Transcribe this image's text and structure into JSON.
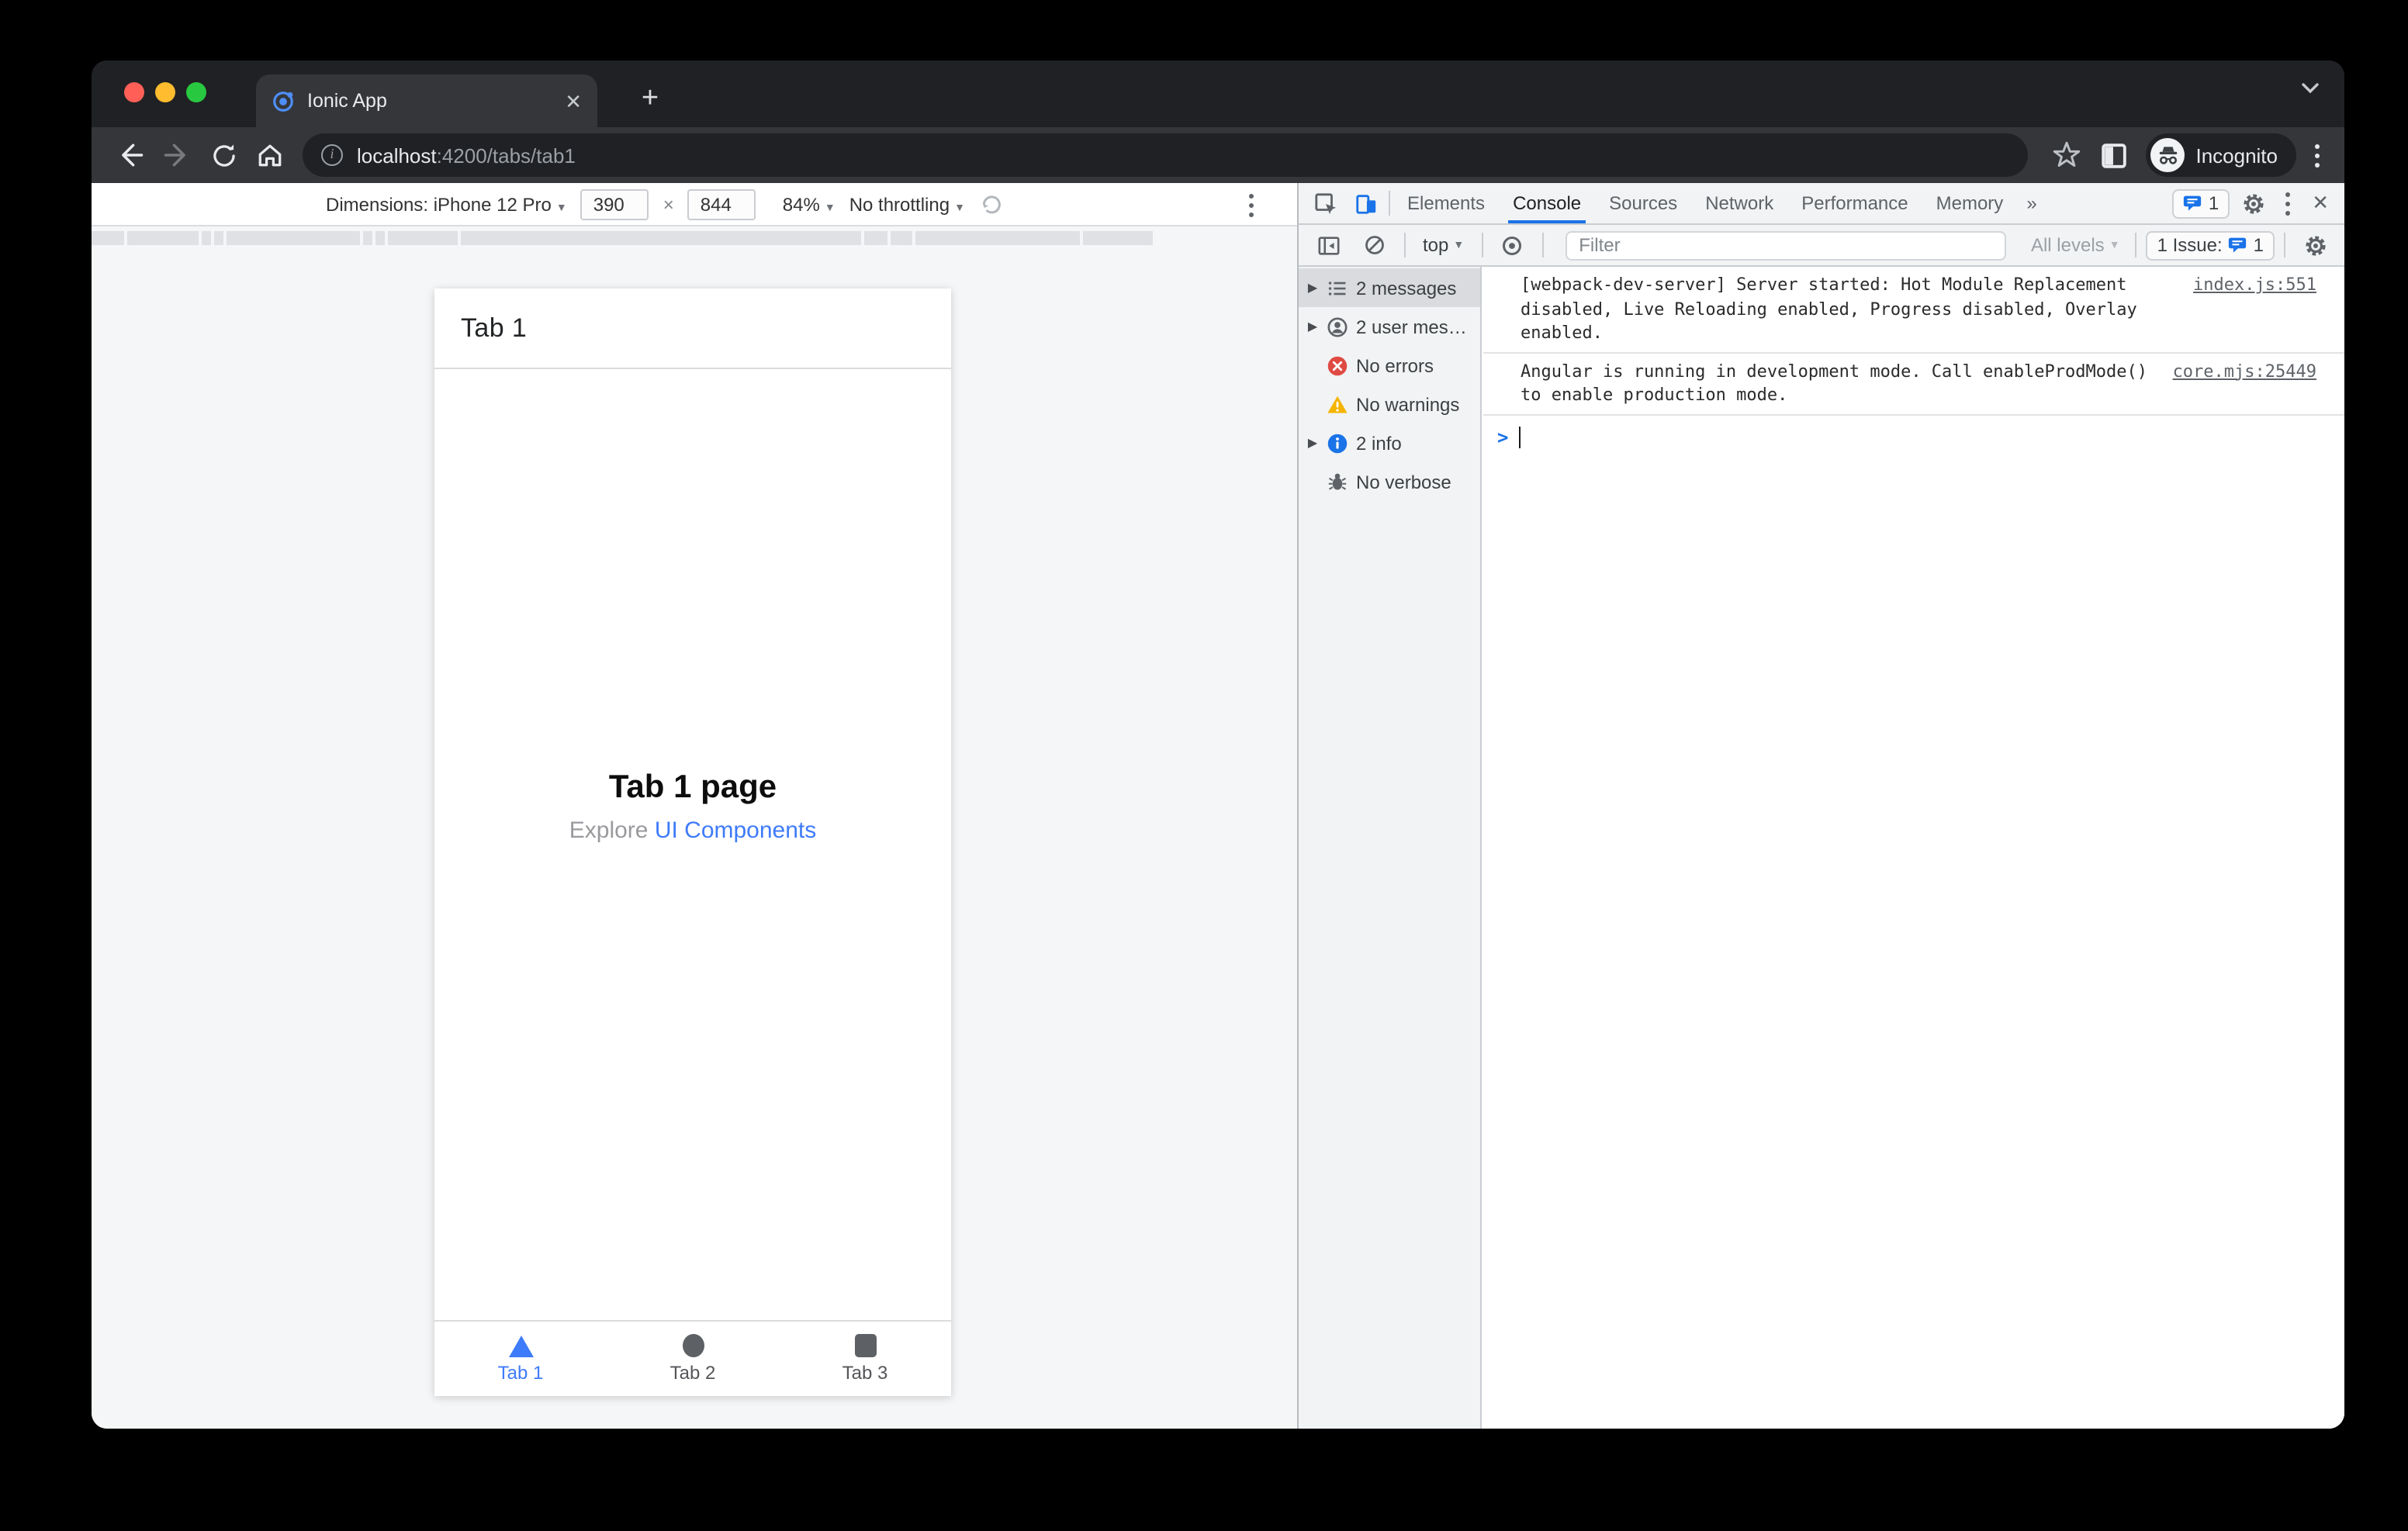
{
  "browser": {
    "tab_title": "Ionic App",
    "new_tab_label": "+",
    "close_tab_label": "✕",
    "url_host": "localhost",
    "url_rest": ":4200/tabs/tab1",
    "incognito_label": "Incognito"
  },
  "device_toolbar": {
    "dimensions_label": "Dimensions: iPhone 12 Pro",
    "width_value": "390",
    "times": "×",
    "height_value": "844",
    "zoom_value": "84%",
    "throttling_value": "No throttling",
    "caret": "▼"
  },
  "devtools": {
    "tabs": [
      {
        "label": "Elements"
      },
      {
        "label": "Console"
      },
      {
        "label": "Sources"
      },
      {
        "label": "Network"
      },
      {
        "label": "Performance"
      },
      {
        "label": "Memory"
      }
    ],
    "more_tabs": "»",
    "tabbar_issue_count": "1",
    "toolbar": {
      "context": "top",
      "filter_placeholder": "Filter",
      "levels": "All levels",
      "issues_label": "1 Issue:",
      "issues_count": "1"
    },
    "sidebar": [
      {
        "label": "2 messages"
      },
      {
        "label": "2 user mes…"
      },
      {
        "label": "No errors"
      },
      {
        "label": "No warnings"
      },
      {
        "label": "2 info"
      },
      {
        "label": "No verbose"
      }
    ],
    "messages": [
      {
        "text": "[webpack-dev-server] Server started: Hot Module Replacement disabled, Live Reloading enabled, Progress disabled, Overlay enabled.",
        "source": "index.js:551"
      },
      {
        "text": "Angular is running in development mode. Call enableProdMode() to enable production mode.",
        "source": "core.mjs:25449"
      }
    ],
    "prompt": ">"
  },
  "app": {
    "header_title": "Tab 1",
    "page_heading": "Tab 1 page",
    "explore_prefix": "Explore ",
    "explore_link": "UI Components",
    "tabs": [
      {
        "label": "Tab 1"
      },
      {
        "label": "Tab 2"
      },
      {
        "label": "Tab 3"
      }
    ]
  },
  "colors": {
    "traffic_red": "#ff5f57",
    "traffic_yellow": "#febc2e",
    "traffic_green": "#28c840",
    "devtools_accent": "#1a73e8",
    "ionic_blue": "#3e7bfa",
    "error_red": "#df4a42",
    "warning_yellow": "#f5b400",
    "chrome_dark": "#202124"
  }
}
